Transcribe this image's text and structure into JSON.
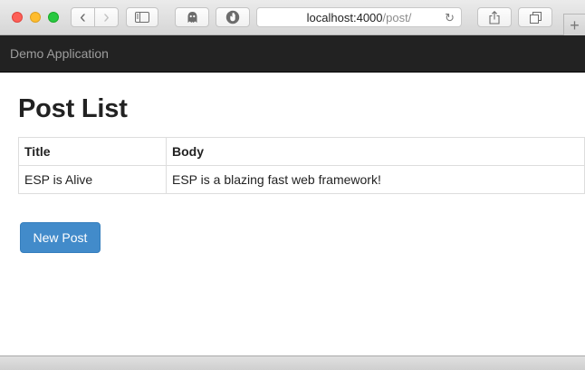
{
  "browser": {
    "url_host": "localhost:4000",
    "url_path": "/post/",
    "icons": {
      "back": "chevron-left-icon",
      "forward": "chevron-right-icon",
      "sidebar": "sidebar-icon",
      "ghost": "ghost-icon",
      "shield": "shield-icon",
      "reload": "reload-icon",
      "share": "share-icon",
      "tabs": "tabs-icon",
      "new_tab": "plus-icon"
    },
    "glyphs": {
      "back": "‹",
      "forward": "›",
      "reload": "↻",
      "new_tab": "+"
    }
  },
  "navbar": {
    "brand": "Demo Application",
    "background": "#222222"
  },
  "main": {
    "title": "Post List",
    "table": {
      "headers": [
        "Title",
        "Body"
      ],
      "rows": [
        [
          "ESP is Alive",
          "ESP is a blazing fast web framework!"
        ]
      ]
    },
    "new_post_label": "New Post",
    "accent": "#428bca"
  }
}
